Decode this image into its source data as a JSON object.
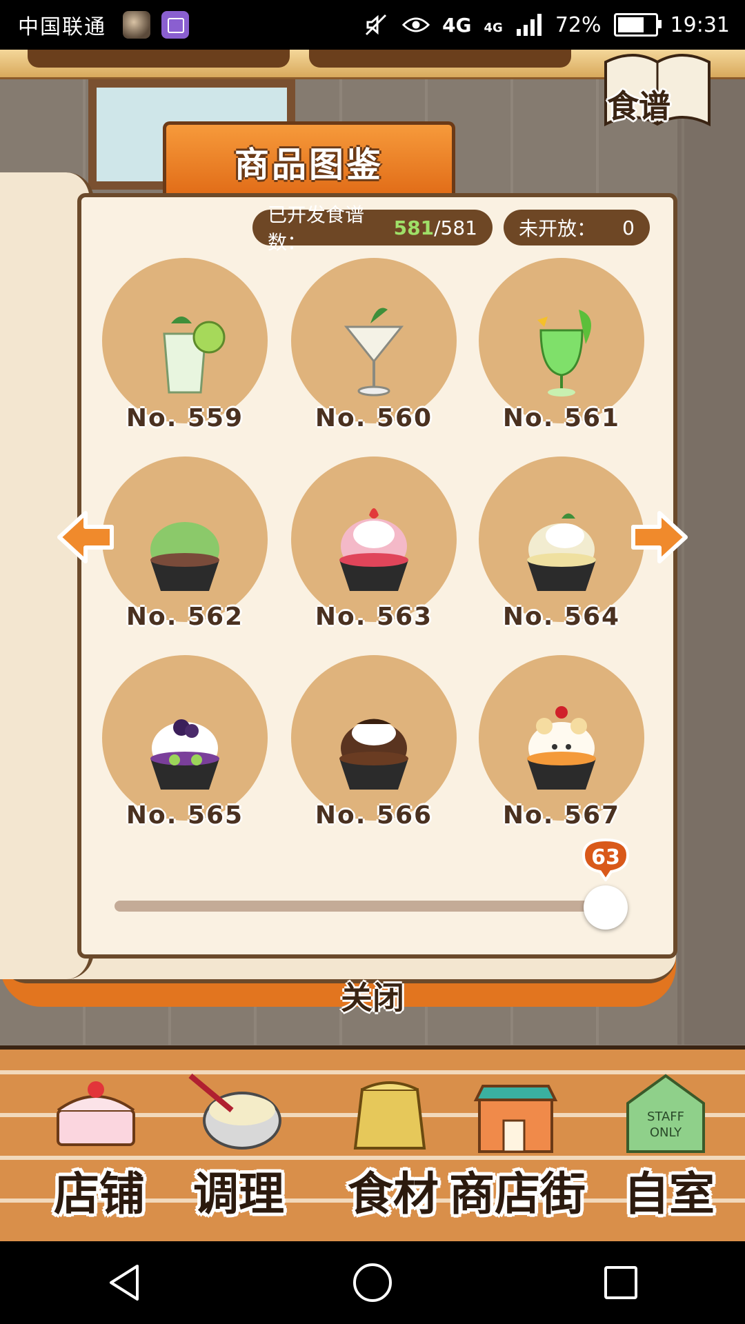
{
  "status_bar": {
    "carrier": "中国联通",
    "network_1": "4G",
    "network_2": "4G",
    "battery_text": "72%",
    "battery_level": 0.72,
    "time": "19:31"
  },
  "header": {
    "recipe_button_label": "食谱",
    "panel_title": "商品图鉴"
  },
  "stats": {
    "developed_label": "已开发食谱数：",
    "developed_count": "581",
    "developed_total": "/581",
    "unreleased_label": "未开放：",
    "unreleased_count": "0"
  },
  "recipes": [
    {
      "number": "No. 559",
      "icon": "mojito-glass-icon"
    },
    {
      "number": "No. 560",
      "icon": "martini-glass-icon"
    },
    {
      "number": "No. 561",
      "icon": "melon-soda-icon"
    },
    {
      "number": "No. 562",
      "icon": "matcha-shaved-ice-icon"
    },
    {
      "number": "No. 563",
      "icon": "strawberry-shaved-ice-icon"
    },
    {
      "number": "No. 564",
      "icon": "fruit-shaved-ice-icon"
    },
    {
      "number": "No. 565",
      "icon": "blueberry-shaved-ice-icon"
    },
    {
      "number": "No. 566",
      "icon": "chocolate-shaved-ice-icon"
    },
    {
      "number": "No. 567",
      "icon": "bear-shaved-ice-icon"
    }
  ],
  "pager": {
    "prev_icon": "arrow-left-icon",
    "next_icon": "arrow-right-icon",
    "page_value": "63",
    "slider_level": 1.0
  },
  "close_label": "关闭",
  "bottom_nav": [
    {
      "label": "店铺",
      "icon": "cake-icon"
    },
    {
      "label": "调理",
      "icon": "whisk-bowl-icon"
    },
    {
      "label": "食材",
      "icon": "flour-sack-icon"
    },
    {
      "label": "商店街",
      "icon": "shop-street-icon"
    },
    {
      "label": "自室",
      "icon": "staff-only-door-icon"
    }
  ],
  "staff_sign": "STAFF ONLY",
  "colors": {
    "accent_orange": "#e06a16",
    "pill_brown": "#6e4725",
    "count_green": "#9fe068",
    "disc": "#d9a86a"
  }
}
